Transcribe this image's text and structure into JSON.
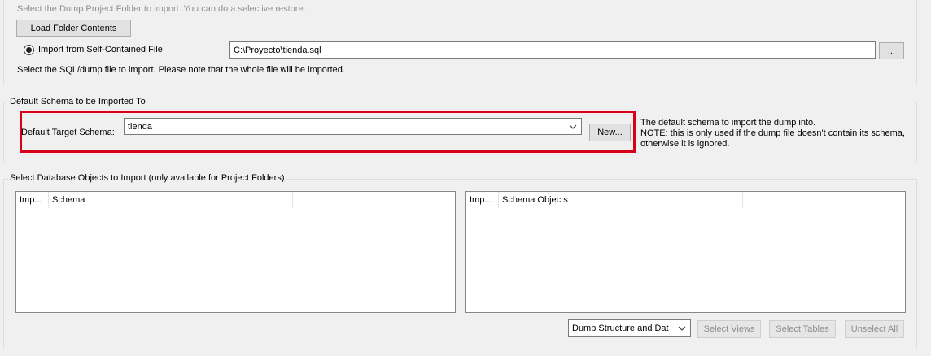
{
  "top": {
    "folder_hint": "Select the Dump Project Folder to import. You can do a selective restore.",
    "load_folder_button": "Load Folder Contents",
    "radio_label": "Import from Self-Contained File",
    "file_path": "C:\\Proyecto\\tienda.sql",
    "browse_button": "...",
    "file_hint": "Select the SQL/dump file to import. Please note that the whole file will be imported."
  },
  "schema_group": {
    "title": "Default Schema to be Imported To",
    "target_label": "Default Target Schema:",
    "selected_schema": "tienda",
    "new_button": "New...",
    "note_line1": "The default schema to import the dump into.",
    "note_line2": "NOTE: this is only used if the dump file doesn't contain its schema,",
    "note_line3": "otherwise it is ignored."
  },
  "objects_group": {
    "title": "Select Database Objects to Import (only available for Project Folders)",
    "left_list": {
      "col_import": "Imp...",
      "col_name": "Schema"
    },
    "right_list": {
      "col_import": "Imp...",
      "col_name": "Schema Objects"
    },
    "dump_mode": "Dump Structure and Dat",
    "select_views_button": "Select Views",
    "select_tables_button": "Select Tables",
    "unselect_all_button": "Unselect All"
  },
  "colors": {
    "highlight": "#d9001b",
    "disabled_text": "#8e8e8e"
  }
}
